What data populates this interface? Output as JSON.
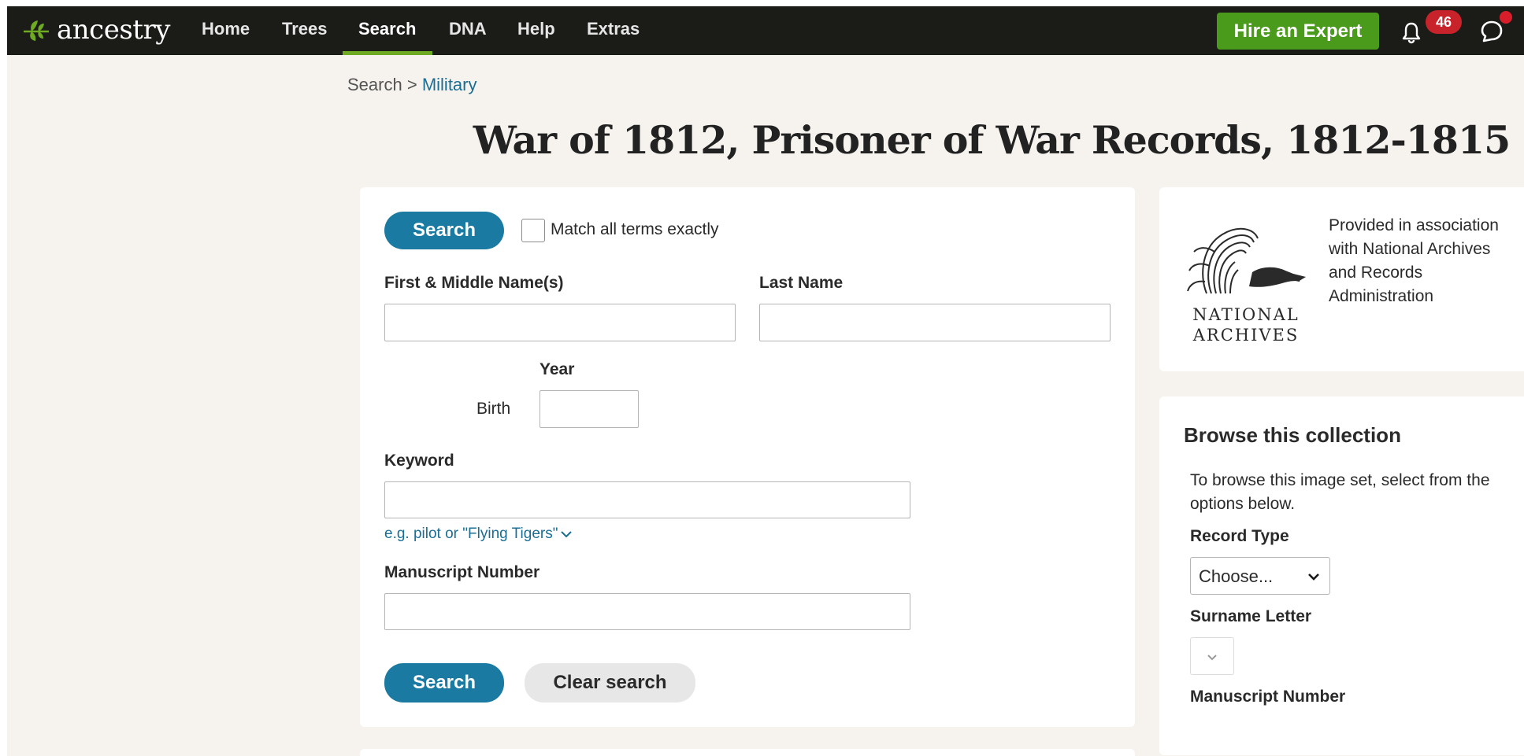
{
  "nav": {
    "logo": "ancestry",
    "items": [
      {
        "label": "Home"
      },
      {
        "label": "Trees"
      },
      {
        "label": "Search"
      },
      {
        "label": "DNA"
      },
      {
        "label": "Help"
      },
      {
        "label": "Extras"
      }
    ],
    "active": "Search",
    "hire_expert": "Hire an Expert",
    "notification_count": "46",
    "icons": [
      "ancestry-leaf-icon",
      "bell-icon",
      "message-icon"
    ],
    "colors": {
      "bar": "#1b1c18",
      "accent": "#6fab22",
      "hire": "#4a9a1c",
      "badge": "#c8232b"
    }
  },
  "breadcrumb": {
    "root": "Search",
    "separator": ">",
    "current": "Military"
  },
  "page_title": "War of 1812, Prisoner of War Records, 1812-1815",
  "search_form": {
    "search_button": "Search",
    "match_exact_label": "Match all terms exactly",
    "first_name_label": "First & Middle Name(s)",
    "first_name_value": "",
    "last_name_label": "Last Name",
    "last_name_value": "",
    "year_label": "Year",
    "birth_label": "Birth",
    "birth_year_value": "",
    "keyword_label": "Keyword",
    "keyword_value": "",
    "keyword_hint": "e.g. pilot or \"Flying Tigers\"",
    "manuscript_label": "Manuscript Number",
    "manuscript_value": "",
    "clear_button": "Clear search",
    "primary_color": "#1b7aa1"
  },
  "provider": {
    "logo_line1": "NATIONAL",
    "logo_line2": "ARCHIVES",
    "text": "Provided in association with National Archives and Records Administration"
  },
  "browse": {
    "title": "Browse this collection",
    "description": "To browse this image set, select from the options below.",
    "record_type_label": "Record Type",
    "record_type_value": "Choose...",
    "surname_letter_label": "Surname Letter",
    "manuscript_label": "Manuscript Number"
  }
}
